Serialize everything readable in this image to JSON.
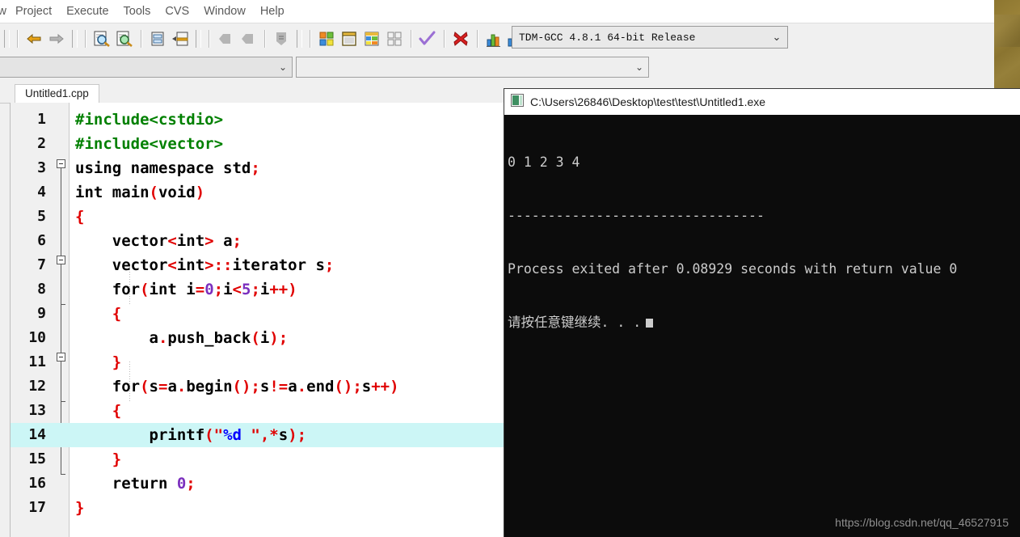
{
  "app": {
    "menu": [
      {
        "label": "w",
        "name": "menu-view-clipped"
      },
      {
        "label": "Project",
        "name": "menu-project"
      },
      {
        "label": "Execute",
        "name": "menu-execute"
      },
      {
        "label": "Tools",
        "name": "menu-tools"
      },
      {
        "label": "CVS",
        "name": "menu-cvs"
      },
      {
        "label": "Window",
        "name": "menu-window"
      },
      {
        "label": "Help",
        "name": "menu-help"
      }
    ],
    "toolbar": {
      "icons": [
        {
          "name": "undo-icon",
          "label": "Undo"
        },
        {
          "name": "redo-icon",
          "label": "Redo"
        },
        {
          "name": "find-icon",
          "label": "Find"
        },
        {
          "name": "replace-icon",
          "label": "Replace"
        },
        {
          "name": "goto-line-icon",
          "label": "Goto line"
        },
        {
          "name": "indent-icon",
          "label": "Indent"
        },
        {
          "name": "back-icon",
          "label": "Back"
        },
        {
          "name": "forward-icon",
          "label": "Forward"
        },
        {
          "name": "toggle-panel-icon",
          "label": "Toggle panel"
        },
        {
          "name": "compile-icon",
          "label": "Compile"
        },
        {
          "name": "run-icon",
          "label": "Run"
        },
        {
          "name": "compile-run-icon",
          "label": "Compile & Run"
        },
        {
          "name": "rebuild-icon",
          "label": "Rebuild all"
        },
        {
          "name": "syntax-check-icon",
          "label": "Syntax check"
        },
        {
          "name": "stop-execution-icon",
          "label": "Stop execution"
        },
        {
          "name": "profile-icon",
          "label": "Profile analysis"
        },
        {
          "name": "delete-profile-icon",
          "label": "Delete profiling info"
        }
      ]
    },
    "combos": {
      "scope_value": ")",
      "member_value": "",
      "compiler_value": "TDM-GCC 4.8.1 64-bit Release",
      "arrow_glyph": "⌄"
    }
  },
  "editor": {
    "tab_label": "Untitled1.cpp",
    "highlighted_line": 14,
    "lines": [
      {
        "n": "1",
        "tokens": [
          {
            "t": "#include<cstdio>",
            "c": "s-pre"
          }
        ]
      },
      {
        "n": "2",
        "tokens": [
          {
            "t": "#include<vector>",
            "c": "s-pre"
          }
        ]
      },
      {
        "n": "3",
        "tokens": [
          {
            "t": "using namespace std",
            "c": "s-kw"
          },
          {
            "t": ";",
            "c": "s-op"
          }
        ]
      },
      {
        "n": "4",
        "tokens": [
          {
            "t": "int main",
            "c": "s-kw"
          },
          {
            "t": "(",
            "c": "s-op"
          },
          {
            "t": "void",
            "c": "s-kw"
          },
          {
            "t": ")",
            "c": "s-op"
          }
        ]
      },
      {
        "n": "5",
        "tokens": [
          {
            "t": "{",
            "c": "s-op"
          }
        ]
      },
      {
        "n": "6",
        "tokens": [
          {
            "t": "    vector",
            "c": "s-kw"
          },
          {
            "t": "<",
            "c": "s-op"
          },
          {
            "t": "int",
            "c": "s-kw"
          },
          {
            "t": ">",
            "c": "s-op"
          },
          {
            "t": " a",
            "c": "s-kw"
          },
          {
            "t": ";",
            "c": "s-op"
          }
        ]
      },
      {
        "n": "7",
        "tokens": [
          {
            "t": "    vector",
            "c": "s-kw"
          },
          {
            "t": "<",
            "c": "s-op"
          },
          {
            "t": "int",
            "c": "s-kw"
          },
          {
            "t": ">::",
            "c": "s-op"
          },
          {
            "t": "iterator s",
            "c": "s-kw"
          },
          {
            "t": ";",
            "c": "s-op"
          }
        ]
      },
      {
        "n": "8",
        "tokens": [
          {
            "t": "    for",
            "c": "s-kw"
          },
          {
            "t": "(",
            "c": "s-op"
          },
          {
            "t": "int i",
            "c": "s-kw"
          },
          {
            "t": "=",
            "c": "s-op"
          },
          {
            "t": "0",
            "c": "s-num"
          },
          {
            "t": ";",
            "c": "s-op"
          },
          {
            "t": "i",
            "c": "s-kw"
          },
          {
            "t": "<",
            "c": "s-op"
          },
          {
            "t": "5",
            "c": "s-num"
          },
          {
            "t": ";",
            "c": "s-op"
          },
          {
            "t": "i",
            "c": "s-kw"
          },
          {
            "t": "++)",
            "c": "s-op"
          }
        ]
      },
      {
        "n": "9",
        "tokens": [
          {
            "t": "    {",
            "c": "s-op"
          }
        ]
      },
      {
        "n": "10",
        "tokens": [
          {
            "t": "        a",
            "c": "s-kw"
          },
          {
            "t": ".",
            "c": "s-op"
          },
          {
            "t": "push_back",
            "c": "s-kw"
          },
          {
            "t": "(",
            "c": "s-op"
          },
          {
            "t": "i",
            "c": "s-kw"
          },
          {
            "t": ");",
            "c": "s-op"
          }
        ]
      },
      {
        "n": "11",
        "tokens": [
          {
            "t": "    }",
            "c": "s-op"
          }
        ]
      },
      {
        "n": "12",
        "tokens": [
          {
            "t": "    for",
            "c": "s-kw"
          },
          {
            "t": "(",
            "c": "s-op"
          },
          {
            "t": "s",
            "c": "s-kw"
          },
          {
            "t": "=",
            "c": "s-op"
          },
          {
            "t": "a",
            "c": "s-kw"
          },
          {
            "t": ".",
            "c": "s-op"
          },
          {
            "t": "begin",
            "c": "s-kw"
          },
          {
            "t": "();",
            "c": "s-op"
          },
          {
            "t": "s",
            "c": "s-kw"
          },
          {
            "t": "!=",
            "c": "s-op"
          },
          {
            "t": "a",
            "c": "s-kw"
          },
          {
            "t": ".",
            "c": "s-op"
          },
          {
            "t": "end",
            "c": "s-kw"
          },
          {
            "t": "();",
            "c": "s-op"
          },
          {
            "t": "s",
            "c": "s-kw"
          },
          {
            "t": "++)",
            "c": "s-op"
          }
        ]
      },
      {
        "n": "13",
        "tokens": [
          {
            "t": "    {",
            "c": "s-op"
          }
        ]
      },
      {
        "n": "14",
        "tokens": [
          {
            "t": "        printf",
            "c": "s-kw"
          },
          {
            "t": "(",
            "c": "s-op"
          },
          {
            "t": "\"",
            "c": "s-op"
          },
          {
            "t": "%d ",
            "c": "s-str"
          },
          {
            "t": "\"",
            "c": "s-op"
          },
          {
            "t": ",",
            "c": "s-op"
          },
          {
            "t": "*",
            "c": "s-op"
          },
          {
            "t": "s",
            "c": "s-kw"
          },
          {
            "t": ");",
            "c": "s-op"
          }
        ]
      },
      {
        "n": "15",
        "tokens": [
          {
            "t": "    }",
            "c": "s-op"
          }
        ]
      },
      {
        "n": "16",
        "tokens": [
          {
            "t": "    return ",
            "c": "s-kw"
          },
          {
            "t": "0",
            "c": "s-num"
          },
          {
            "t": ";",
            "c": "s-op"
          }
        ]
      },
      {
        "n": "17",
        "tokens": [
          {
            "t": "}",
            "c": "s-op"
          }
        ]
      }
    ]
  },
  "console": {
    "title": "C:\\Users\\26846\\Desktop\\test\\test\\Untitled1.exe",
    "output_lines": [
      "0 1 2 3 4",
      "--------------------------------",
      "Process exited after 0.08929 seconds with return value 0",
      "请按任意键继续. . ."
    ],
    "watermark": "https://blog.csdn.net/qq_46527915"
  },
  "colors": {
    "highlight_line": "#ccf6f6",
    "console_bg": "#0c0c0c",
    "console_fg": "#cccccc",
    "preprocessor": "#008000",
    "operator": "#e00000",
    "number": "#7b2fbe",
    "string": "#0000ff",
    "wallpaper": "#8d7630"
  }
}
